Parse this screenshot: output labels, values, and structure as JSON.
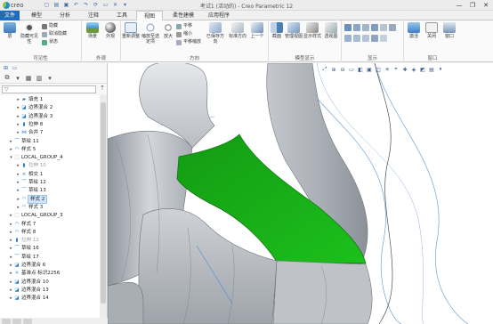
{
  "app": {
    "logo_word": "creo",
    "window_title": "考试1 (活动的) - Creo Parametric 12"
  },
  "quick_access": [
    "new-icon",
    "open-icon",
    "save-icon",
    "undo-icon",
    "redo-icon",
    "regenerate-icon",
    "window-icon",
    "close-icon",
    "dropdown-icon"
  ],
  "window_controls": {
    "minimize": "—",
    "maximize": "❐",
    "close": "✕"
  },
  "tabs": [
    {
      "label": "文件"
    },
    {
      "label": "模型"
    },
    {
      "label": "分析"
    },
    {
      "label": "注释"
    },
    {
      "label": "工具"
    },
    {
      "label": "视图"
    },
    {
      "label": "柔性建模"
    },
    {
      "label": "应用程序"
    }
  ],
  "ribbon": {
    "visibility": {
      "label": "可见性",
      "buttons": {
        "layers": "层",
        "hide": "隐藏可见性",
        "status": "状态"
      },
      "small": {
        "hide": "隐藏",
        "show": "取消隐藏",
        "status": "状态"
      }
    },
    "appearance": {
      "label": "外观",
      "buttons": {
        "scene": "场景",
        "appearance": "外观"
      },
      "small": {
        "model_tree": "模型",
        "display": "显示"
      }
    },
    "orientation": {
      "label": "方向",
      "buttons": {
        "refit": "重新调整",
        "zoom_to_selected": "缩放至选定项",
        "zoom_in": "放大",
        "pan": "平移",
        "zoom_out": "缩小",
        "pan_zoom": "平移缩放",
        "saved_orientations": "已保存方向",
        "standard": "标准方向",
        "previous": "上一个"
      }
    },
    "model_display": {
      "label": "模型显示",
      "buttons": {
        "section": "截面",
        "manage_views": "管理视图",
        "display_style": "显示样式",
        "perspective": "透视图"
      }
    },
    "show": {
      "label": "显示"
    },
    "window": {
      "label": "窗口",
      "buttons": {
        "activate": "激活",
        "close": "关闭",
        "windows": "窗口"
      }
    }
  },
  "tree": [
    {
      "label": "填充 1",
      "icon": "fill-icon",
      "indent": 2,
      "arrow": "▸",
      "dim": false,
      "selected": false
    },
    {
      "label": "边界混合 2",
      "icon": "boundary-blend-icon",
      "indent": 2,
      "arrow": "▸",
      "dim": false,
      "selected": false
    },
    {
      "label": "边界混合 3",
      "icon": "boundary-blend-icon",
      "indent": 2,
      "arrow": "▸",
      "dim": false,
      "selected": false
    },
    {
      "label": "拉伸 8",
      "icon": "extrude-icon",
      "indent": 2,
      "arrow": "▸",
      "dim": false,
      "selected": false
    },
    {
      "label": "合并 7",
      "icon": "merge-icon",
      "indent": 2,
      "arrow": "▸",
      "dim": false,
      "selected": false
    },
    {
      "label": "草绘 11",
      "icon": "sketch-icon",
      "indent": 1,
      "arrow": "▸",
      "dim": false,
      "selected": false
    },
    {
      "label": "样式 5",
      "icon": "style-icon",
      "indent": 1,
      "arrow": "▸",
      "dim": false,
      "selected": false
    },
    {
      "label": "LOCAL_GROUP_4",
      "icon": "group-icon",
      "indent": 1,
      "arrow": "▾",
      "dim": false,
      "selected": false
    },
    {
      "label": "拉伸 10",
      "icon": "extrude-icon",
      "indent": 2,
      "arrow": "▸",
      "dim": true,
      "selected": false
    },
    {
      "label": "相交 1",
      "icon": "intersect-icon",
      "indent": 2,
      "arrow": "▸",
      "dim": false,
      "selected": false
    },
    {
      "label": "草绘 12",
      "icon": "sketch-icon",
      "indent": 2,
      "arrow": "▸",
      "dim": false,
      "selected": false
    },
    {
      "label": "草绘 13",
      "icon": "sketch-icon",
      "indent": 2,
      "arrow": "▸",
      "dim": false,
      "selected": false
    },
    {
      "label": "样式 2",
      "icon": "style-icon",
      "indent": 2,
      "arrow": "▸",
      "dim": false,
      "selected": true
    },
    {
      "label": "样式 3",
      "icon": "style-icon",
      "indent": 2,
      "arrow": "▸",
      "dim": false,
      "selected": false
    },
    {
      "label": "LOCAL_GROUP_3",
      "icon": "group-icon",
      "indent": 1,
      "arrow": "▸",
      "dim": false,
      "selected": false
    },
    {
      "label": "样式 7",
      "icon": "style-icon",
      "indent": 1,
      "arrow": "▸",
      "dim": false,
      "selected": false
    },
    {
      "label": "样式 8",
      "icon": "style-icon",
      "indent": 1,
      "arrow": "▸",
      "dim": false,
      "selected": false
    },
    {
      "label": "拉伸 12",
      "icon": "extrude-icon",
      "indent": 1,
      "arrow": "▸",
      "dim": true,
      "selected": false
    },
    {
      "label": "草绘 16",
      "icon": "sketch-icon",
      "indent": 1,
      "arrow": "▸",
      "dim": false,
      "selected": false
    },
    {
      "label": "草绘 17",
      "icon": "sketch-icon",
      "indent": 1,
      "arrow": "▸",
      "dim": false,
      "selected": false
    },
    {
      "label": "边界混合 6",
      "icon": "boundary-blend-icon",
      "indent": 1,
      "arrow": "▸",
      "dim": false,
      "selected": false
    },
    {
      "label": "基准点 标识2256",
      "icon": "datum-point-icon",
      "indent": 1,
      "arrow": "▸",
      "dim": false,
      "selected": false
    },
    {
      "label": "边界混合 10",
      "icon": "boundary-blend-icon",
      "indent": 1,
      "arrow": "▸",
      "dim": false,
      "selected": false
    },
    {
      "label": "边界混合 13",
      "icon": "boundary-blend-icon",
      "indent": 1,
      "arrow": "▸",
      "dim": false,
      "selected": false
    },
    {
      "label": "边界混合 14",
      "icon": "boundary-blend-icon",
      "indent": 1,
      "arrow": "▸",
      "dim": false,
      "selected": false
    }
  ],
  "colors": {
    "file_tab": "#1f6bbd",
    "surface_highlight": "#1fb01f",
    "model_gray": "#b8bcc3",
    "datum_curve": "#4a8fd0"
  }
}
